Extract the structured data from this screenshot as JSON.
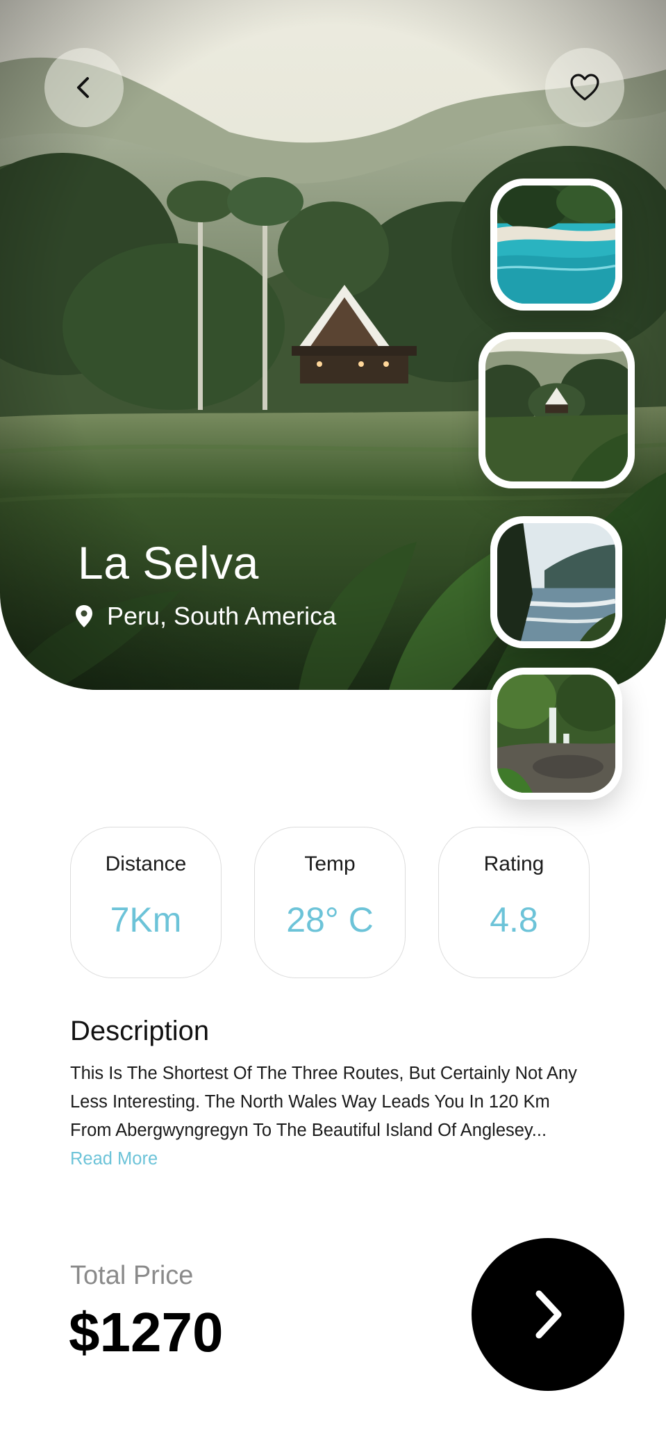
{
  "hero": {
    "title": "La Selva",
    "location": "Peru, South America",
    "icons": {
      "back": "chevron-left-icon",
      "favorite": "heart-outline-icon",
      "location": "location-pin-icon"
    }
  },
  "gallery": {
    "thumbnails": [
      "beach",
      "jungle-cabin",
      "coastline",
      "waterfall"
    ],
    "selected_index": 1
  },
  "stats": [
    {
      "label": "Distance",
      "value": "7Km"
    },
    {
      "label": "Temp",
      "value": "28° C"
    },
    {
      "label": "Rating",
      "value": "4.8"
    }
  ],
  "description": {
    "title": "Description",
    "text": "This Is The Shortest Of The Three Routes, But Certainly Not Any Less Interesting. The North Wales Way Leads You In 120 Km From Abergwyngregyn To The Beautiful Island Of Anglesey...",
    "read_more": "Read More"
  },
  "price": {
    "label": "Total Price",
    "value": "$1270"
  },
  "colors": {
    "accent": "#6cc3d8",
    "primary_button": "#000000",
    "text": "#1a1a1a",
    "muted": "#8a8a8a"
  }
}
